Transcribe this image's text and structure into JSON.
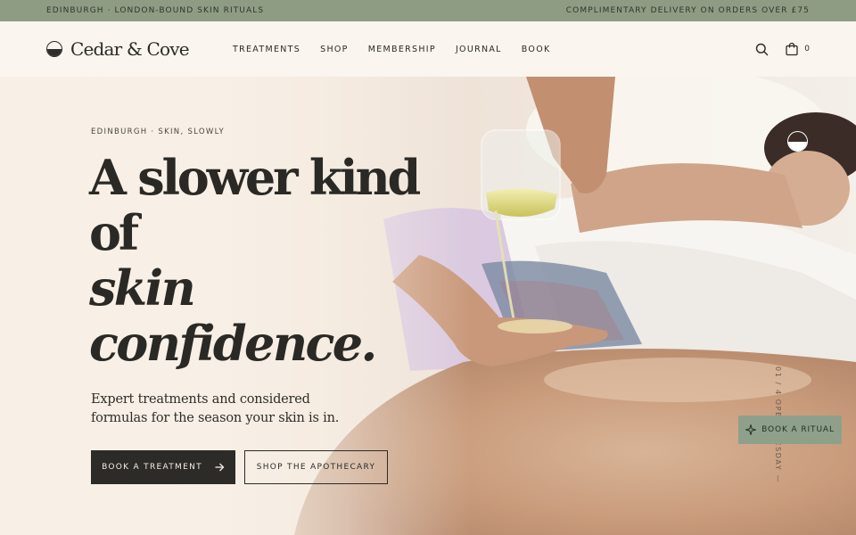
{
  "announcement": {
    "left": "EDINBURGH · LONDON-BOUND SKIN RITUALS",
    "right": "COMPLIMENTARY DELIVERY ON ORDERS OVER £75"
  },
  "header": {
    "brand": "Cedar & Cove",
    "nav": [
      "TREATMENTS",
      "SHOP",
      "MEMBERSHIP",
      "JOURNAL",
      "BOOK"
    ],
    "cart_count": "0"
  },
  "hero": {
    "eyebrow": "EDINBURGH · SKIN, SLOWLY",
    "headline_line1": "A slower kind",
    "headline_line2": "of",
    "headline_line3": "skin",
    "headline_line4": "confidence.",
    "subtitle": "Expert treatments and considered formulas for the season your skin is in.",
    "primary_cta": "BOOK A TREATMENT",
    "secondary_cta": "SHOP THE APOTHECARY",
    "vertical_text": "01 / 4   OPEN TUESDAY — SATURDAY"
  },
  "floating_button": {
    "label": "BOOK A RITUAL"
  },
  "icons": {
    "search": "search-icon",
    "cart": "bag-icon",
    "arrow": "arrow-right-icon",
    "sparkle": "sparkle-icon"
  },
  "colors": {
    "announcement_bg": "#8e9c84",
    "header_bg": "#faf5ee",
    "primary_button": "#2c2b28",
    "floating_button": "#8fa08a"
  }
}
